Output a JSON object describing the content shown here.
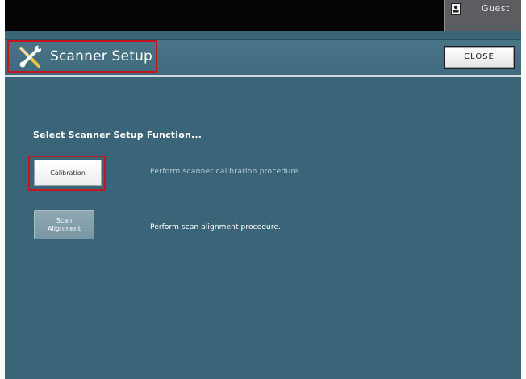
{
  "top_bar": {
    "user_label": "Guest",
    "icon": "user-login-icon"
  },
  "title_bar": {
    "title": "Scanner Setup",
    "icon": "tools-icon",
    "close_label": "CLOSE"
  },
  "main": {
    "prompt": "Select Scanner Setup Function...",
    "functions": [
      {
        "label": "Calibration",
        "description": "Perform scanner calibration procedure."
      },
      {
        "label_line1": "Scan",
        "label_line2": "Alignment",
        "description": "Perform scan alignment procedure."
      }
    ]
  },
  "colors": {
    "background": "#3a6477",
    "top_bar": "#050505",
    "highlight": "#c4161c"
  }
}
